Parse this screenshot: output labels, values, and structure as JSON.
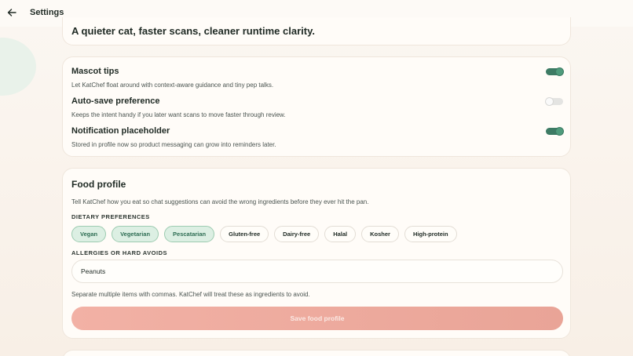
{
  "header": {
    "title": "Settings",
    "back_icon": "arrow-left-icon"
  },
  "intro": {
    "tagline": "A quieter cat, faster scans, cleaner runtime clarity."
  },
  "preferences": [
    {
      "title": "Mascot tips",
      "description": "Let KatChef float around with context-aware guidance and tiny pep talks.",
      "enabled": true
    },
    {
      "title": "Auto-save preference",
      "description": "Keeps the intent handy if you later want scans to move faster through review.",
      "enabled": false
    },
    {
      "title": "Notification placeholder",
      "description": "Stored in profile now so product messaging can grow into reminders later.",
      "enabled": true
    }
  ],
  "food_profile": {
    "title": "Food profile",
    "description": "Tell KatChef how you eat so chat suggestions can avoid the wrong ingredients before they ever hit the pan.",
    "dietary_label": "DIETARY PREFERENCES",
    "chips": [
      {
        "label": "Vegan",
        "selected": true
      },
      {
        "label": "Vegetarian",
        "selected": true
      },
      {
        "label": "Pescatarian",
        "selected": true
      },
      {
        "label": "Gluten-free",
        "selected": false
      },
      {
        "label": "Dairy-free",
        "selected": false
      },
      {
        "label": "Halal",
        "selected": false
      },
      {
        "label": "Kosher",
        "selected": false
      },
      {
        "label": "High-protein",
        "selected": false
      }
    ],
    "allergies_label": "ALLERGIES OR HARD AVOIDS",
    "allergies_value": "Peanuts",
    "hint": "Separate multiple items with commas. KatChef will treat these as ingredients to avoid.",
    "save_label": "Save food profile"
  },
  "colors": {
    "accent_green": "#3d7b64",
    "chip_selected_bg": "#dcefe3",
    "save_button": "#f2b1a5"
  }
}
